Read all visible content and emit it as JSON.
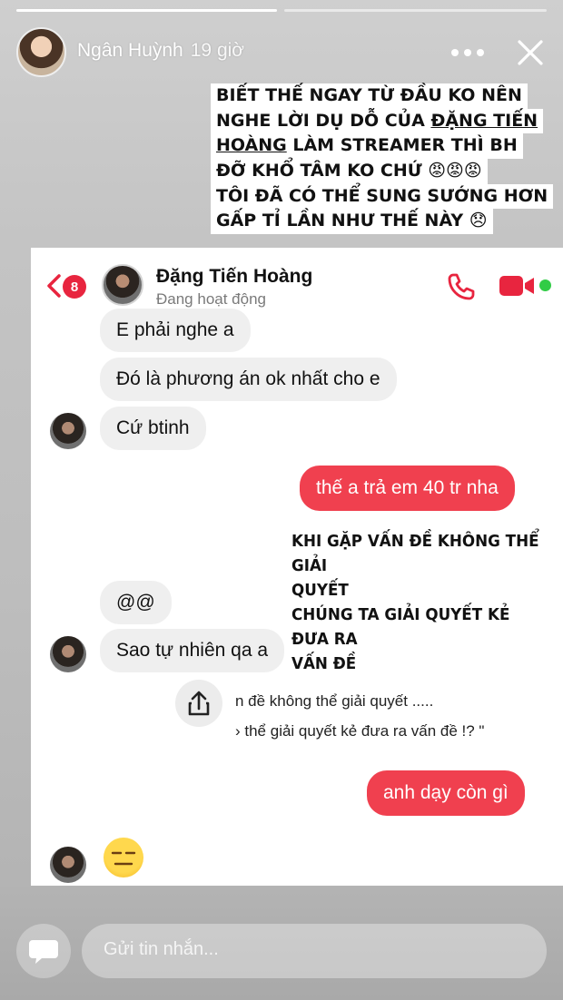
{
  "story": {
    "progress": [
      1,
      0
    ],
    "user_name": "Ngân Huỳnh",
    "time_ago": "19 giờ"
  },
  "caption": {
    "lines": [
      "BIẾT THẾ NGAY TỪ ĐẦU KO NÊN",
      "NGHE LỜI DỤ DỖ CỦA ",
      "ĐẶNG TIẾN",
      "HOÀNG",
      " LÀM STREAMER THÌ BH",
      "ĐỠ KHỔ TÂM KO CHỨ 😡😡😡",
      "TÔI ĐÃ CÓ THỂ SUNG SƯỚNG HƠN",
      "GẤP TỈ LẦN NHƯ THẾ NÀY 😞"
    ]
  },
  "chat": {
    "unread_badge": "8",
    "contact_name": "Đặng Tiến Hoàng",
    "contact_status": "Đang hoạt động",
    "messages": {
      "m1": "E phải nghe a",
      "m2": "Đó là phương án ok nhất cho e",
      "m3": "Cứ btinh",
      "m4": "thế a trả em 40 tr nha",
      "m5": "@@",
      "m6": "Sao tự nhiên qa a",
      "m7": "anh dạy còn gì",
      "m8": "😑"
    },
    "handwritten": [
      "KHI GẶP VẤN ĐỀ KHÔNG THỂ GIẢI",
      "QUYẾT",
      "CHÚNG TA GIẢI QUYẾT KẺ ĐƯA RA",
      "VẤN ĐỀ"
    ],
    "shared_quote": [
      "n đề không thể giải quyết .....",
      "› thể giải quyết kẻ đưa ra vấn đề !? \""
    ]
  },
  "reply": {
    "placeholder": "Gửi tin nhắn..."
  },
  "colors": {
    "accent_red": "#f0404f",
    "online_green": "#31cc46",
    "badge_red": "#e8253f"
  },
  "icons": [
    "more-icon",
    "close-icon",
    "back-arrow-icon",
    "phone-icon",
    "video-camera-icon",
    "share-icon",
    "message-bubble-icon"
  ]
}
